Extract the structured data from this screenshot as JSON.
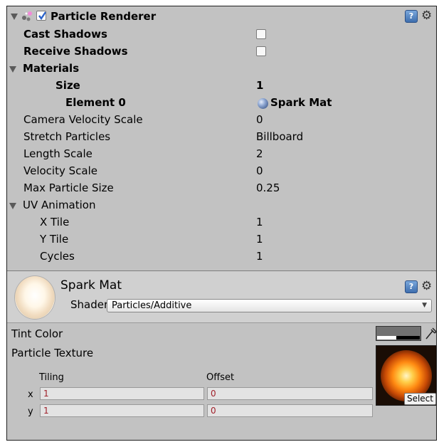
{
  "component": {
    "title": "Particle Renderer",
    "enabled": true,
    "properties": [
      {
        "label": "Cast Shadows",
        "type": "checkbox",
        "checked": false
      },
      {
        "label": "Receive Shadows",
        "type": "checkbox",
        "checked": false
      }
    ],
    "materials": {
      "label": "Materials",
      "size_label": "Size",
      "size_value": "1",
      "element_label": "Element 0",
      "element_value": "Spark Mat"
    },
    "rows": [
      {
        "label": "Camera Velocity Scale",
        "value": "0"
      },
      {
        "label": "Stretch Particles",
        "value": "Billboard"
      },
      {
        "label": "Length Scale",
        "value": "2"
      },
      {
        "label": "Velocity Scale",
        "value": "0"
      },
      {
        "label": "Max Particle Size",
        "value": "0.25"
      }
    ],
    "uv_animation": {
      "label": "UV Animation",
      "rows": [
        {
          "label": "X Tile",
          "value": "1"
        },
        {
          "label": "Y Tile",
          "value": "1"
        },
        {
          "label": "Cycles",
          "value": "1"
        }
      ]
    }
  },
  "material": {
    "name": "Spark Mat",
    "shader_label": "Shader",
    "shader_value": "Particles/Additive",
    "tint_label": "Tint Color",
    "texture_label": "Particle Texture",
    "tiling_label": "Tiling",
    "offset_label": "Offset",
    "x_label": "x",
    "y_label": "y",
    "tiling_x": "1",
    "tiling_y": "1",
    "offset_x": "0",
    "offset_y": "0",
    "select_label": "Select"
  },
  "icons": {
    "help": "?",
    "gear": "⚙"
  },
  "colors": {
    "panel_bg": "#c2c2c2",
    "checkbox_check": "#2a62c9"
  }
}
